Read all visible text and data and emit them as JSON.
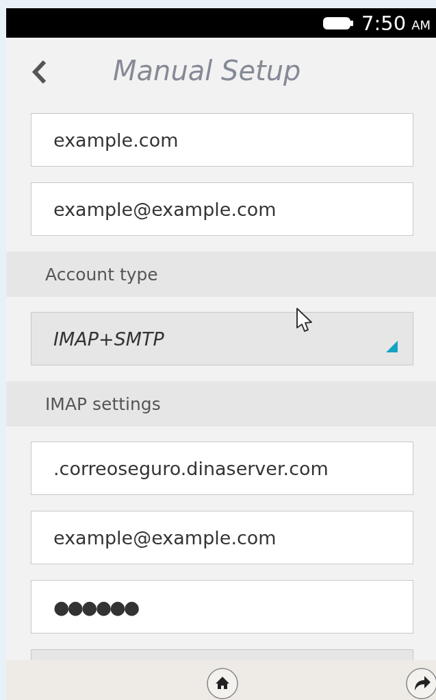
{
  "status_bar": {
    "time": "7:50",
    "meridiem": "AM"
  },
  "header": {
    "title": "Manual Setup"
  },
  "items": [
    {
      "kind": "field",
      "value": "example.com"
    },
    {
      "kind": "field",
      "value": "example@example.com"
    },
    {
      "kind": "section",
      "label": "Account type"
    },
    {
      "kind": "select",
      "value": "IMAP+SMTP"
    },
    {
      "kind": "section",
      "label": "IMAP settings"
    },
    {
      "kind": "field",
      "value": ".correoseguro.dinaserver.com"
    },
    {
      "kind": "field",
      "value": "example@example.com"
    },
    {
      "kind": "password",
      "value": "●●●●●●"
    }
  ]
}
